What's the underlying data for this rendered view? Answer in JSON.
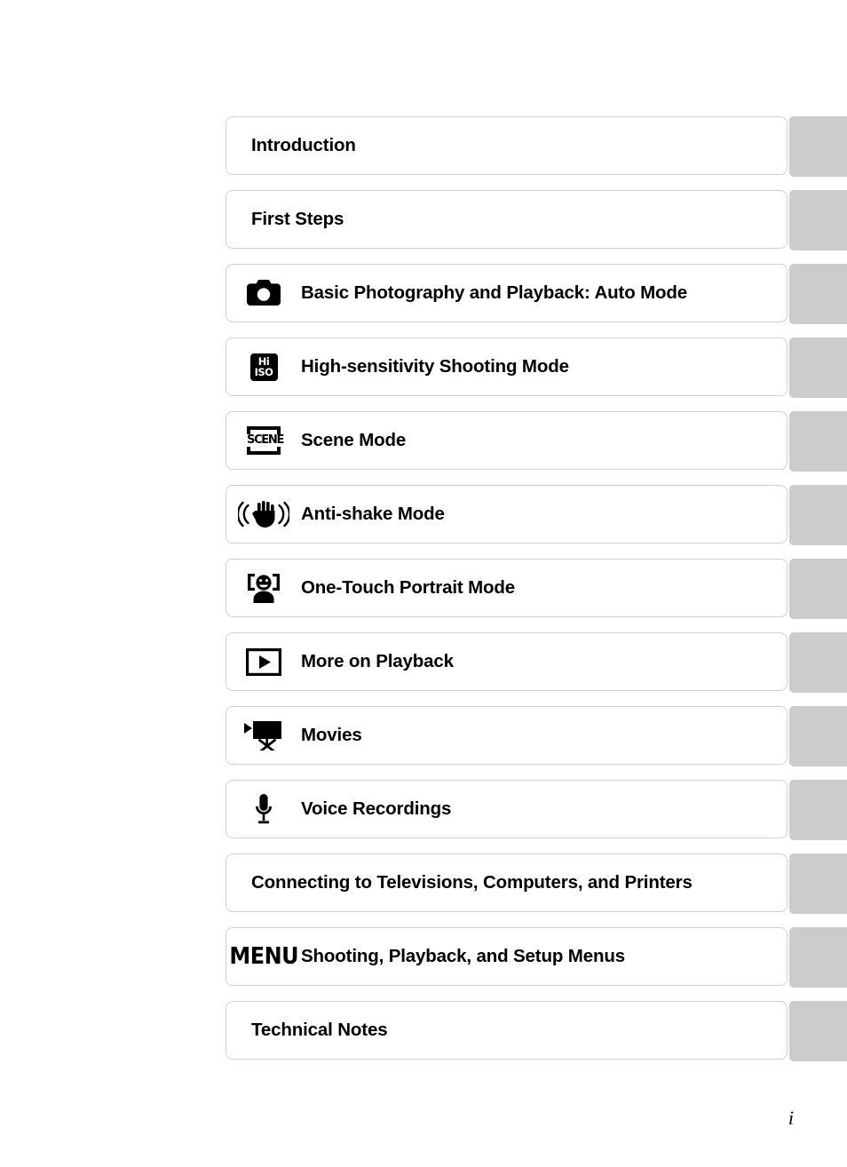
{
  "document": {
    "type": "table-of-contents",
    "page_number": "i",
    "tab_color": "#cccccc",
    "box_border_color": "#d2d2d2",
    "text_color": "#000000"
  },
  "toc": {
    "rows": [
      {
        "icon": null,
        "icon_text": null,
        "label": "Introduction"
      },
      {
        "icon": null,
        "icon_text": null,
        "label": "First Steps"
      },
      {
        "icon": "camera-icon",
        "icon_text": null,
        "label": "Basic Photography and Playback: Auto Mode"
      },
      {
        "icon": "hi-iso-icon",
        "icon_text": "Hi ISO",
        "label": "High-sensitivity Shooting Mode"
      },
      {
        "icon": "scene-icon",
        "icon_text": "SCENE",
        "label": "Scene Mode"
      },
      {
        "icon": "anti-shake-hand-icon",
        "icon_text": null,
        "label": "Anti-shake Mode"
      },
      {
        "icon": "one-touch-portrait-icon",
        "icon_text": null,
        "label": "One-Touch Portrait Mode"
      },
      {
        "icon": "playback-icon",
        "icon_text": null,
        "label": "More on Playback"
      },
      {
        "icon": "movie-camera-icon",
        "icon_text": null,
        "label": "Movies"
      },
      {
        "icon": "microphone-icon",
        "icon_text": null,
        "label": "Voice Recordings"
      },
      {
        "icon": null,
        "icon_text": null,
        "label": "Connecting to Televisions, Computers, and Printers"
      },
      {
        "icon": "menu-icon",
        "icon_text": "MENU",
        "label": "Shooting, Playback, and Setup Menus"
      },
      {
        "icon": null,
        "icon_text": null,
        "label": "Technical Notes"
      }
    ]
  }
}
